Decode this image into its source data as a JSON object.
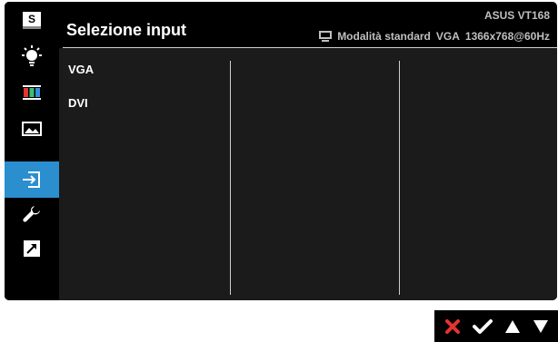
{
  "osd": {
    "title": "Selezione input",
    "model": "ASUS VT168",
    "status": {
      "mode": "Modalità standard",
      "input": "VGA",
      "resolution": "1366x768@60Hz",
      "icon": "monitor-icon"
    }
  },
  "sidebar": {
    "items": [
      {
        "name": "splendid",
        "icon": "s-logo-icon"
      },
      {
        "name": "brightness",
        "icon": "sun-icon"
      },
      {
        "name": "color",
        "icon": "color-bars-icon"
      },
      {
        "name": "image",
        "icon": "picture-icon"
      },
      {
        "name": "input-select",
        "icon": "input-source-icon",
        "active": true
      },
      {
        "name": "system-setup",
        "icon": "wrench-icon"
      },
      {
        "name": "shortcut",
        "icon": "shortcut-arrow-icon"
      }
    ],
    "s_label": "S"
  },
  "options": [
    "VGA",
    "DVI"
  ],
  "keys": {
    "close": {
      "icon": "close-icon",
      "color": "#e3342f"
    },
    "confirm": {
      "icon": "check-icon"
    },
    "up": {
      "icon": "triangle-up-icon"
    },
    "down": {
      "icon": "triangle-down-icon"
    }
  },
  "colors": {
    "active": "#2b8ecf",
    "panel": "#1b1b1b",
    "background": "#000000",
    "close": "#e3342f"
  }
}
